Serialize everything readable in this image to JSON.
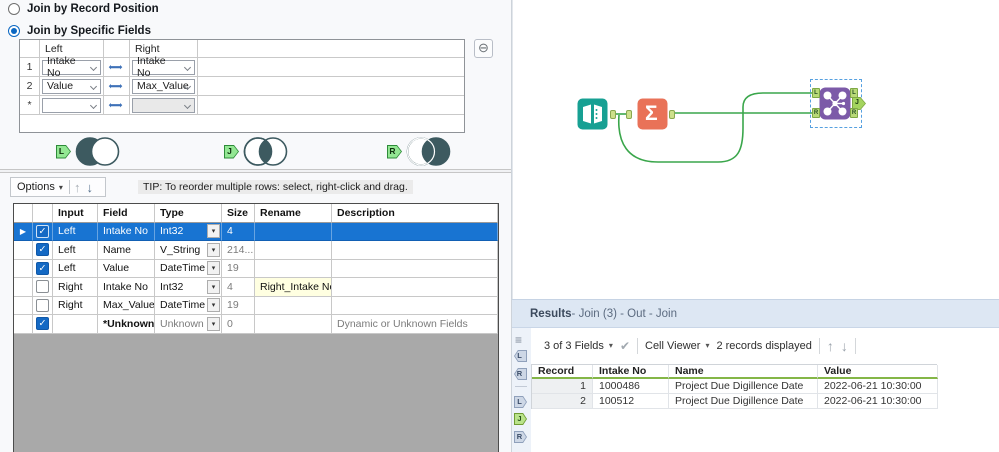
{
  "icons": {
    "caret": "▾",
    "check": "✓",
    "bold_check": "✔",
    "pointer": "▶",
    "minus_circle": "⊖",
    "menu": "≡",
    "up": "↑",
    "down": "↓",
    "left_arrow": "⬅",
    "right_arrow": "➡",
    "sigma": "Σ"
  },
  "colors": {
    "accent_blue": "#1874d2",
    "venn_dark": "#3d5a60",
    "wire_green": "#3aa64b",
    "anchor_green": "#b5d977",
    "input_teal": "#17a093",
    "summarize_salmon": "#e97258",
    "join_purple": "#7c5aa8",
    "rename_highlight": "#ffffe1",
    "results_header_green": "#84b647"
  },
  "config": {
    "radio_record_position": "Join by Record Position",
    "radio_specific_fields": "Join by Specific Fields",
    "join_table": {
      "left_header": "Left",
      "right_header": "Right",
      "rows": [
        {
          "num": "1",
          "left": "Intake No",
          "right": "Intake No"
        },
        {
          "num": "2",
          "left": "Value",
          "right": "Max_Value"
        },
        {
          "num": "*",
          "left": "",
          "right": ""
        }
      ]
    },
    "venn": {
      "l": "L",
      "j": "J",
      "r": "R"
    },
    "options_label": "Options",
    "tip": "TIP: To reorder multiple rows: select, right-click and drag.",
    "field_table": {
      "headers": {
        "input": "Input",
        "field": "Field",
        "type": "Type",
        "size": "Size",
        "rename": "Rename",
        "description": "Description"
      },
      "rows": [
        {
          "input": "Left",
          "field": "Intake No",
          "type": "Int32",
          "size": "4",
          "rename": "",
          "desc": ""
        },
        {
          "input": "Left",
          "field": "Name",
          "type": "V_String",
          "size": "214...",
          "rename": "",
          "desc": ""
        },
        {
          "input": "Left",
          "field": "Value",
          "type": "DateTime",
          "size": "19",
          "rename": "",
          "desc": ""
        },
        {
          "input": "Right",
          "field": "Intake No",
          "type": "Int32",
          "size": "4",
          "rename": "Right_Intake No",
          "desc": ""
        },
        {
          "input": "Right",
          "field": "Max_Value",
          "type": "DateTime",
          "size": "19",
          "rename": "",
          "desc": ""
        },
        {
          "input": "",
          "field": "*Unknown",
          "type": "Unknown",
          "size": "0",
          "rename": "",
          "desc": "Dynamic or Unknown Fields"
        }
      ]
    }
  },
  "canvas": {
    "join_anchors": {
      "in_l": "L",
      "in_r": "R",
      "out_l": "L",
      "out_j": "J",
      "out_r": "R"
    }
  },
  "results": {
    "title_bold": "Results",
    "title_rest": " - Join (3) - Out - Join",
    "toolbar": {
      "fields_label": "3 of 3 Fields",
      "cell_viewer_label": "Cell Viewer",
      "records_label": "2 records displayed"
    },
    "sidebar": {
      "input_l": "L",
      "input_r": "R",
      "out_l": "L",
      "out_j": "J",
      "out_r": "R"
    },
    "table": {
      "headers": {
        "record": "Record",
        "intake": "Intake No",
        "name": "Name",
        "value": "Value"
      },
      "rows": [
        {
          "record": "1",
          "intake": "1000486",
          "name": "Project Due Digillence Date",
          "value": "2022-06-21 10:30:00"
        },
        {
          "record": "2",
          "intake": "100512",
          "name": "Project Due Digillence Date",
          "value": "2022-06-21 10:30:00"
        }
      ]
    }
  }
}
